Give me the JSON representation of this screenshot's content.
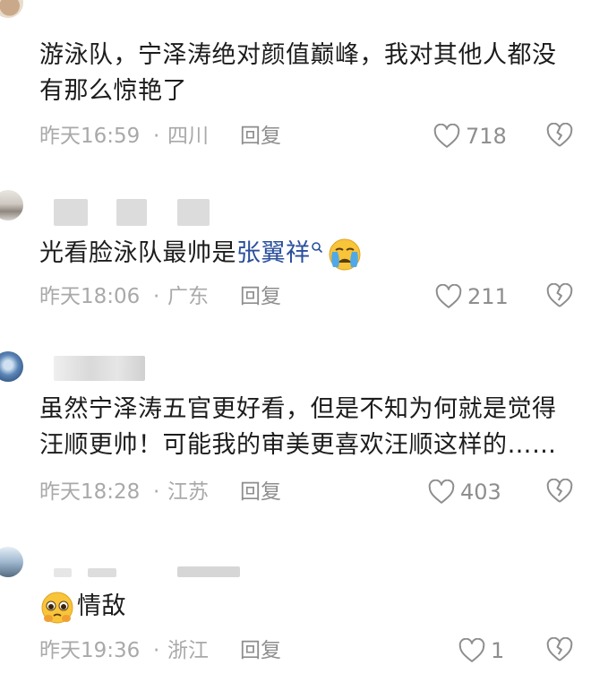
{
  "comments": [
    {
      "text_lines": [
        "游泳队，宁泽涛绝对颜值巅峰，我对其他人都没",
        "有那么惊艳了"
      ],
      "time": "昨天16:59",
      "location": "四川",
      "reply_label": "回复",
      "likes": "718"
    },
    {
      "text": "光看脸泳队最帅是",
      "link": "张翼祥",
      "emoji": "crying-face",
      "time": "昨天18:06",
      "location": "广东",
      "reply_label": "回复",
      "likes": "211"
    },
    {
      "text_lines": [
        "虽然宁泽涛五官更好看，但是不知为何就是觉得",
        "汪顺更帅！可能我的审美更喜欢汪顺这样的……"
      ],
      "time": "昨天18:28",
      "location": "江苏",
      "reply_label": "回复",
      "likes": "403"
    },
    {
      "text": "情敌",
      "emoji": "pleading-face",
      "time": "昨天19:36",
      "location": "浙江",
      "reply_label": "回复",
      "likes": "1"
    }
  ],
  "separator": "·",
  "colors": {
    "link": "#2a4f9c",
    "meta": "#a9a9a9",
    "text": "#1c1c1c"
  }
}
